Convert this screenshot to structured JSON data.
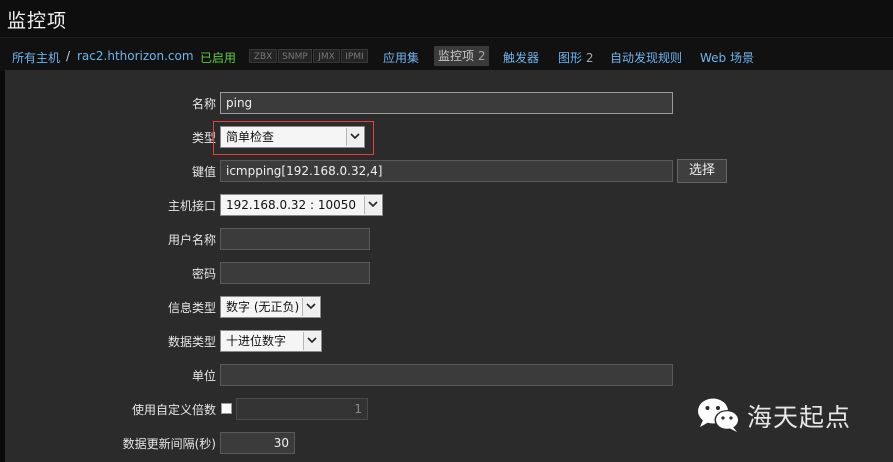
{
  "header": {
    "title": "监控项"
  },
  "nav": {
    "all_hosts": "所有主机",
    "separator": "/",
    "host": "rac2.hthorizon.com",
    "status": "已启用",
    "protocols": [
      "ZBX",
      "SNMP",
      "JMX",
      "IPMI"
    ],
    "applications": "应用集",
    "items": {
      "label": "监控项",
      "count": "2"
    },
    "triggers": "触发器",
    "graphs": {
      "label": "图形",
      "count": "2"
    },
    "discovery": "自动发现规则",
    "web": "Web 场景"
  },
  "form": {
    "name": {
      "label": "名称",
      "value": "ping"
    },
    "type": {
      "label": "类型",
      "value": "简单检查"
    },
    "key": {
      "label": "键值",
      "value": "icmpping[192.168.0.32,4]",
      "button": "选择"
    },
    "host_interface": {
      "label": "主机接口",
      "value": "192.168.0.32 : 10050"
    },
    "username": {
      "label": "用户名称",
      "value": ""
    },
    "password": {
      "label": "密码",
      "value": ""
    },
    "value_type": {
      "label": "信息类型",
      "value": "数字 (无正负)"
    },
    "data_type": {
      "label": "数据类型",
      "value": "十进位数字"
    },
    "units": {
      "label": "单位",
      "value": ""
    },
    "multiplier": {
      "label": "使用自定义倍数",
      "value": "1"
    },
    "update_interval": {
      "label": "数据更新间隔(秒)",
      "value": "30"
    }
  },
  "watermark": {
    "text": "海天起点",
    "icon": "wechat-icon"
  },
  "colors": {
    "link": "#6fb4ec",
    "enabled": "#5fcb3c",
    "highlight": "#e2413b"
  }
}
